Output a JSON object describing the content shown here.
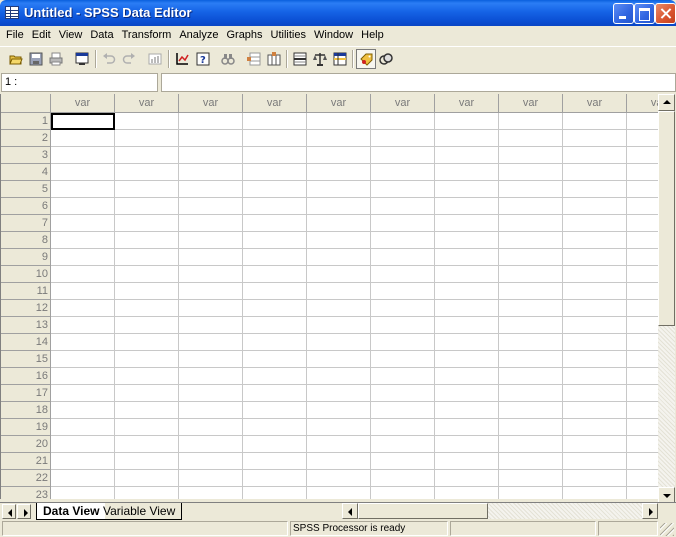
{
  "window": {
    "title": "Untitled - SPSS Data Editor",
    "icon": "spreadsheet-icon",
    "controls": [
      "minimize-icon",
      "maximize-icon",
      "close-icon"
    ]
  },
  "menu": [
    "File",
    "Edit",
    "View",
    "Data",
    "Transform",
    "Analyze",
    "Graphs",
    "Utilities",
    "Window",
    "Help"
  ],
  "toolbar": {
    "buttons": [
      {
        "name": "open-file-icon"
      },
      {
        "name": "save-icon"
      },
      {
        "name": "print-icon"
      },
      {
        "name": "dialog-recall-icon"
      },
      {
        "name": "undo-icon"
      },
      {
        "name": "redo-icon"
      },
      {
        "name": "goto-chart-icon"
      },
      {
        "name": "goto-case-icon"
      },
      {
        "name": "variables-icon"
      },
      {
        "name": "find-icon"
      },
      {
        "name": "insert-case-icon"
      },
      {
        "name": "insert-variable-icon"
      },
      {
        "name": "split-file-icon"
      },
      {
        "name": "weight-cases-icon"
      },
      {
        "name": "select-cases-icon"
      },
      {
        "name": "value-labels-icon",
        "pressed": true
      },
      {
        "name": "use-sets-icon"
      }
    ]
  },
  "cell_editor": {
    "reference": "1 :",
    "value": ""
  },
  "grid": {
    "column_header": "var",
    "visible_column_count": 10,
    "last_column_partial": "va",
    "rows": [
      "1",
      "2",
      "3",
      "4",
      "5",
      "6",
      "7",
      "8",
      "9",
      "10",
      "11",
      "12",
      "13",
      "14",
      "15",
      "16",
      "17",
      "18",
      "19",
      "20",
      "21",
      "22",
      "23"
    ],
    "active_cell": {
      "row": 1,
      "col": 1
    }
  },
  "tabs": {
    "data_view": "Data View",
    "variable_view": "Variable View",
    "active": "data_view"
  },
  "status": {
    "message": "SPSS Processor  is ready"
  },
  "colors": {
    "titlebar": "#0b4fd4",
    "chrome": "#ece9d8",
    "header_text": "#7a7a7a",
    "grid_line": "#c8c8c8"
  }
}
